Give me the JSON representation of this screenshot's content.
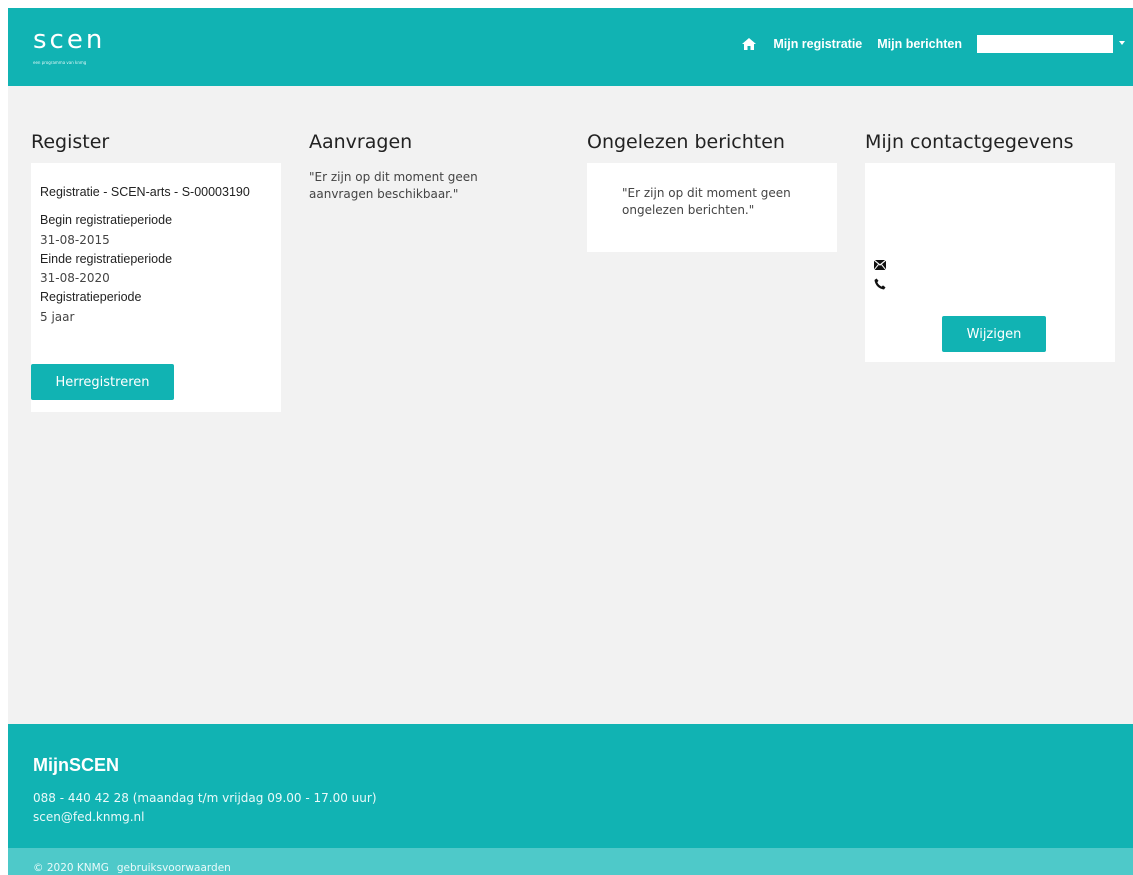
{
  "header": {
    "logo_text": "scen",
    "logo_tagline": "een programma van knmg",
    "nav": {
      "home_icon": "home-icon",
      "registration": "Mijn registratie",
      "messages": "Mijn berichten",
      "account_selected": ""
    }
  },
  "register": {
    "title": "Register",
    "registration_name": "Registratie - SCEN-arts - S-00003190",
    "begin_label": "Begin registratieperiode",
    "begin_value": "31-08-2015",
    "end_label": "Einde registratieperiode",
    "end_value": "31-08-2020",
    "period_label": "Registratieperiode",
    "period_value": "5 jaar",
    "button": "Herregistreren"
  },
  "requests": {
    "title": "Aanvragen",
    "empty_text": "\"Er zijn op dit moment geen aanvragen beschikbaar.\""
  },
  "unread": {
    "title": "Ongelezen berichten",
    "empty_text": "\"Er zijn op dit moment geen ongelezen berichten.\""
  },
  "contact": {
    "title": "Mijn contactgegevens",
    "email_icon": "envelope-icon",
    "phone_icon": "phone-icon",
    "button": "Wijzigen"
  },
  "footer": {
    "title": "MijnSCEN",
    "phone_line": "088 - 440 42 28 (maandag t/m vrijdag 09.00 - 17.00 uur)",
    "email": "scen@fed.knmg.nl",
    "copyright": "© 2020 KNMG",
    "terms": "gebruiksvoorwaarden"
  },
  "colors": {
    "brand": "#11b3b3",
    "brand_light": "#4ec9c9",
    "page_bg": "#f2f2f2"
  }
}
